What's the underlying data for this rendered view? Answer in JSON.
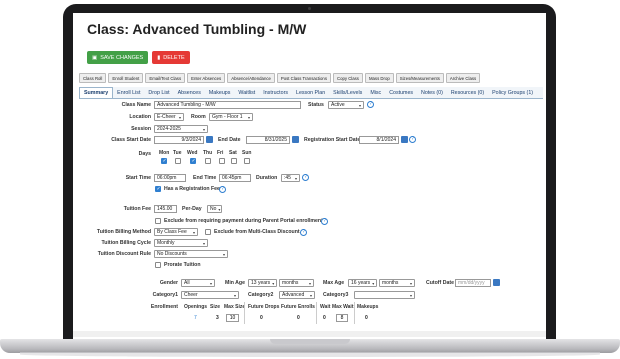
{
  "page": {
    "title": "Class: Advanced Tumbling - M/W"
  },
  "actions": {
    "save_label": "SAVE CHANGES",
    "delete_label": "DELETE"
  },
  "top_tabs": [
    "Class Roll",
    "Enroll Student",
    "Email/Text Class",
    "Enter Absences",
    "Absence/Attendance",
    "Post Class Transactions",
    "Copy Class",
    "Mass Drop",
    "Sizes/Measurements",
    "Archive Class"
  ],
  "sub_tabs": [
    "Summary",
    "Enroll List",
    "Drop List",
    "Absences",
    "Makeups",
    "Waitlist",
    "Instructors",
    "Lesson Plan",
    "Skills/Levels",
    "Misc",
    "Costumes",
    "Notes (0)",
    "Resources (0)",
    "Policy Groups (1)"
  ],
  "form": {
    "class_name_label": "Class Name",
    "class_name_value": "Advanced Tumbling - M/W",
    "status_label": "Status",
    "status_value": "Active",
    "location_label": "Location",
    "location_value": "E-Cheer",
    "room_label": "Room",
    "room_value": "Gym - Floor 1",
    "session_label": "Session",
    "session_value": "2024-2025",
    "start_date_label": "Class Start Date",
    "start_date_value": "9/3/2024",
    "end_date_label": "End Date",
    "end_date_value": "8/31/2025",
    "reg_start_label": "Registration Start Date",
    "reg_start_value": "8/1/2024",
    "days_label": "Days",
    "days": [
      {
        "name": "Mon",
        "checked": true
      },
      {
        "name": "Tue",
        "checked": false
      },
      {
        "name": "Wed",
        "checked": true
      },
      {
        "name": "Thu",
        "checked": false
      },
      {
        "name": "Fri",
        "checked": false
      },
      {
        "name": "Sat",
        "checked": false
      },
      {
        "name": "Sun",
        "checked": false
      }
    ],
    "start_time_label": "Start Time",
    "start_time_value": "06:00pm",
    "end_time_label": "End Time",
    "end_time_value": "06:45pm",
    "duration_label": "Duration",
    "duration_value": ":45",
    "has_reg_fee_label": "Has a Registration Fee",
    "tuition_fee_label": "Tuition Fee",
    "tuition_fee_value": "145.00",
    "per_day_label": "Per-Day",
    "per_day_value": "No",
    "exclude_parent_portal_label": "Exclude from requiring payment during Parent Portal enrollment",
    "billing_method_label": "Tuition Billing Method",
    "billing_method_value": "By Class Fee",
    "exclude_multi_label": "Exclude from Multi-Class Discount",
    "billing_cycle_label": "Tuition Billing Cycle",
    "billing_cycle_value": "Monthly",
    "discount_rule_label": "Tuition Discount Rule",
    "discount_rule_value": "No Discounts",
    "prorate_label": "Prorate Tuition",
    "gender_label": "Gender",
    "gender_value": "All",
    "min_age_label": "Min Age",
    "min_age_years": "13 years",
    "min_age_months": "months",
    "max_age_label": "Max Age",
    "max_age_years": "16 years",
    "max_age_months": "months",
    "cutoff_label": "Cutoff Date",
    "cutoff_placeholder": "mm/dd/yyyy",
    "category1_label": "Category1",
    "category1_value": "Cheer",
    "category2_label": "Category2",
    "category2_value": "Advanced",
    "category3_label": "Category3",
    "category3_value": "",
    "enrollment_label": "Enrollment"
  },
  "enrollment": {
    "headers": [
      "Openings",
      "Size",
      "Max Size",
      "Future Drops",
      "Future Enrolls",
      "Wait",
      "Max Wait",
      "Makeups"
    ],
    "values": [
      "7",
      "3",
      "10",
      "0",
      "0",
      "0",
      "8",
      "0"
    ]
  },
  "colors": {
    "save": "#43a047",
    "delete": "#e53935",
    "link": "#2f7fd0"
  }
}
